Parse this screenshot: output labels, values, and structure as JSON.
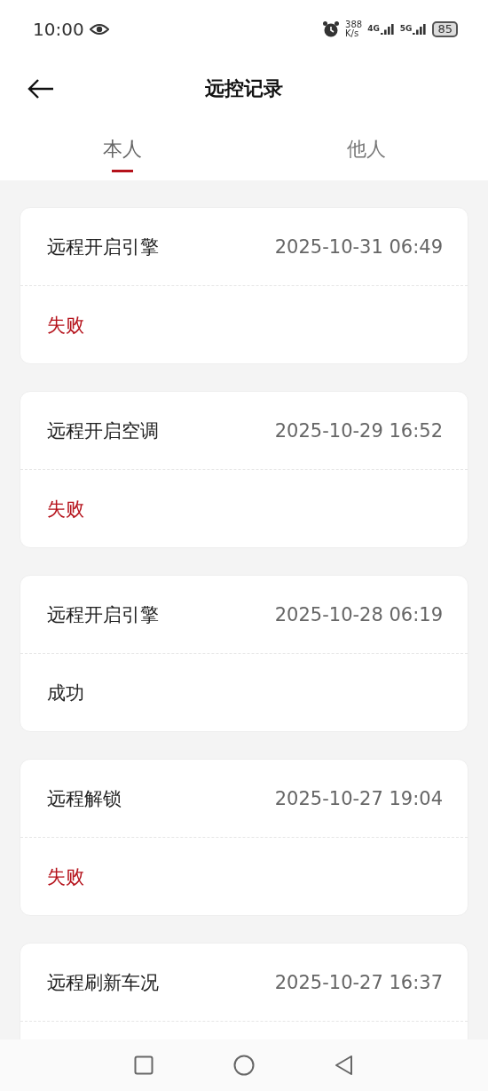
{
  "status_bar": {
    "time": "10:00",
    "speed": "388",
    "speed_unit": "K/s",
    "network_1": "4G",
    "network_2": "5G",
    "battery": "85"
  },
  "header": {
    "title": "远控记录"
  },
  "tabs": [
    {
      "label": "本人",
      "selected": true
    },
    {
      "label": "他人",
      "selected": false
    }
  ],
  "records": [
    {
      "action": "远程开启引擎",
      "time": "2025-10-31 06:49",
      "result": "失败",
      "kind": "failure"
    },
    {
      "action": "远程开启空调",
      "time": "2025-10-29 16:52",
      "result": "失败",
      "kind": "failure"
    },
    {
      "action": "远程开启引擎",
      "time": "2025-10-28 06:19",
      "result": "成功",
      "kind": "success"
    },
    {
      "action": "远程解锁",
      "time": "2025-10-27 19:04",
      "result": "失败",
      "kind": "failure"
    },
    {
      "action": "远程刷新车况",
      "time": "2025-10-27 16:37"
    }
  ]
}
